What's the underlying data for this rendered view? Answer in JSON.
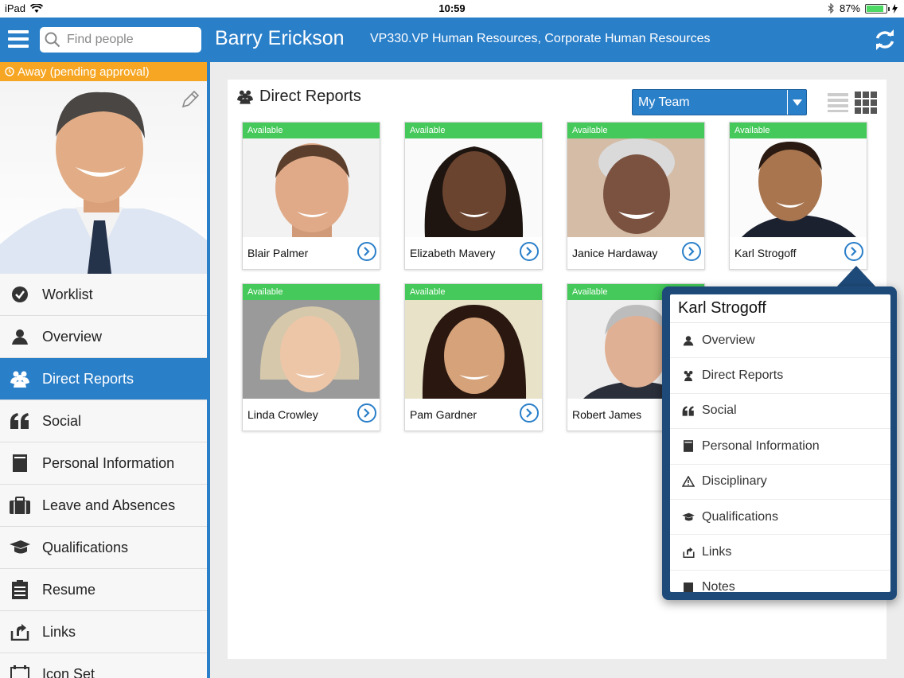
{
  "status_bar": {
    "device": "iPad",
    "time": "10:59",
    "battery": "87%",
    "battery_level": 0.87
  },
  "header": {
    "search_placeholder": "Find people",
    "name": "Barry Erickson",
    "role": "VP330.VP Human Resources, Corporate Human Resources"
  },
  "sidebar": {
    "status": "Away (pending approval)",
    "items": [
      {
        "label": "Worklist",
        "icon": "check-circle-icon"
      },
      {
        "label": "Overview",
        "icon": "person-icon"
      },
      {
        "label": "Direct Reports",
        "icon": "people-icon"
      },
      {
        "label": "Social",
        "icon": "quote-icon"
      },
      {
        "label": "Personal Information",
        "icon": "document-icon"
      },
      {
        "label": "Leave and Absences",
        "icon": "briefcase-icon"
      },
      {
        "label": "Qualifications",
        "icon": "graduation-cap-icon"
      },
      {
        "label": "Resume",
        "icon": "resume-icon"
      },
      {
        "label": "Links",
        "icon": "link-icon"
      },
      {
        "label": "Icon Set",
        "icon": "icon-set-icon"
      }
    ]
  },
  "main": {
    "title": "Direct Reports",
    "team_select": "My Team",
    "reports": [
      {
        "availability": "Available",
        "name": "Blair Palmer"
      },
      {
        "availability": "Available",
        "name": "Elizabeth Mavery"
      },
      {
        "availability": "Available",
        "name": "Janice Hardaway"
      },
      {
        "availability": "Available",
        "name": "Karl Strogoff"
      },
      {
        "availability": "Available",
        "name": "Linda Crowley"
      },
      {
        "availability": "Available",
        "name": "Pam Gardner"
      },
      {
        "availability": "Available",
        "name": "Robert James"
      }
    ]
  },
  "popover": {
    "title": "Karl Strogoff",
    "items": [
      {
        "label": "Overview",
        "icon": "person-icon"
      },
      {
        "label": "Direct Reports",
        "icon": "people-icon"
      },
      {
        "label": "Social",
        "icon": "quote-icon"
      },
      {
        "label": "Personal Information",
        "icon": "document-icon"
      },
      {
        "label": "Disciplinary",
        "icon": "warning-icon"
      },
      {
        "label": "Qualifications",
        "icon": "graduation-cap-icon"
      },
      {
        "label": "Links",
        "icon": "link-icon"
      },
      {
        "label": "Notes",
        "icon": "notes-icon"
      }
    ]
  },
  "colors": {
    "accent": "#2a7fc9",
    "available": "#45c95a",
    "away": "#f6a623",
    "popover": "#1e4a7a"
  }
}
